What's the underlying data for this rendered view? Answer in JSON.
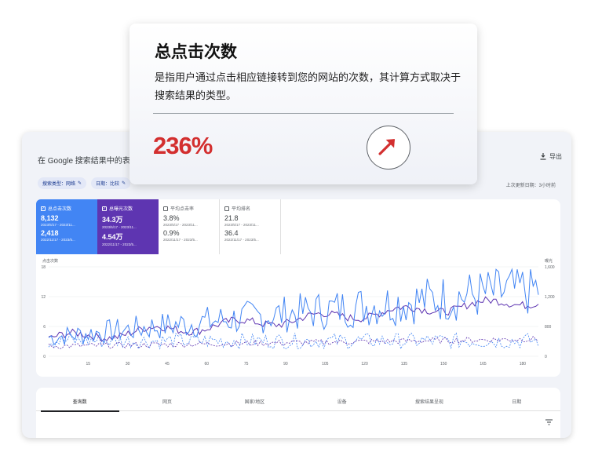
{
  "gsc": {
    "title": "在 Google 搜索结果中的表现",
    "export_label": "导出",
    "chips": [
      "搜索类型：网络",
      "日期：比较"
    ],
    "updated": "上次更新日期：3小时前",
    "metrics": [
      {
        "label": "总点击次数",
        "value_a": "8,132",
        "date_a": "2023/5/17 - 2023/11...",
        "value_b": "2,418",
        "date_b": "2022/11/17 - 2023/5...",
        "checked": true
      },
      {
        "label": "总曝光次数",
        "value_a": "34.3万",
        "date_a": "2023/5/17 - 2023/11...",
        "value_b": "4.54万",
        "date_b": "2022/11/17 - 2023/5...",
        "checked": true
      },
      {
        "label": "平均点击率",
        "value_a": "3.8%",
        "date_a": "2023/5/17 - 2023/11...",
        "value_b": "0.9%",
        "date_b": "2022/11/17 - 2023/5...",
        "checked": false
      },
      {
        "label": "平均排名",
        "value_a": "21.8",
        "date_a": "2023/5/17 - 2023/11...",
        "value_b": "36.4",
        "date_b": "2022/11/17 - 2023/5...",
        "checked": false
      }
    ],
    "tabs": [
      "查询数",
      "网页",
      "国家/地区",
      "设备",
      "搜索结果呈现",
      "日期"
    ]
  },
  "tooltip": {
    "title": "总点击次数",
    "description": "是指用户通过点击相应链接转到您的网站的次数，其计算方式取决于搜索结果的类型。",
    "value": "236%"
  },
  "chart_data": {
    "type": "line",
    "left_axis_label": "点击次数",
    "right_axis_label": "曝光",
    "left_ticks": [
      "18",
      "12",
      "6",
      "0"
    ],
    "right_ticks": [
      "1,600",
      "1,200",
      "800",
      "0"
    ],
    "x_ticks": [
      "15",
      "30",
      "45",
      "60",
      "75",
      "90",
      "105",
      "120",
      "135",
      "150",
      "165",
      "180"
    ],
    "left_ylim": [
      0,
      18
    ],
    "right_ylim": [
      0,
      1600
    ],
    "colors": {
      "clicks": "#4285f4",
      "impressions": "#5e35b1"
    }
  }
}
